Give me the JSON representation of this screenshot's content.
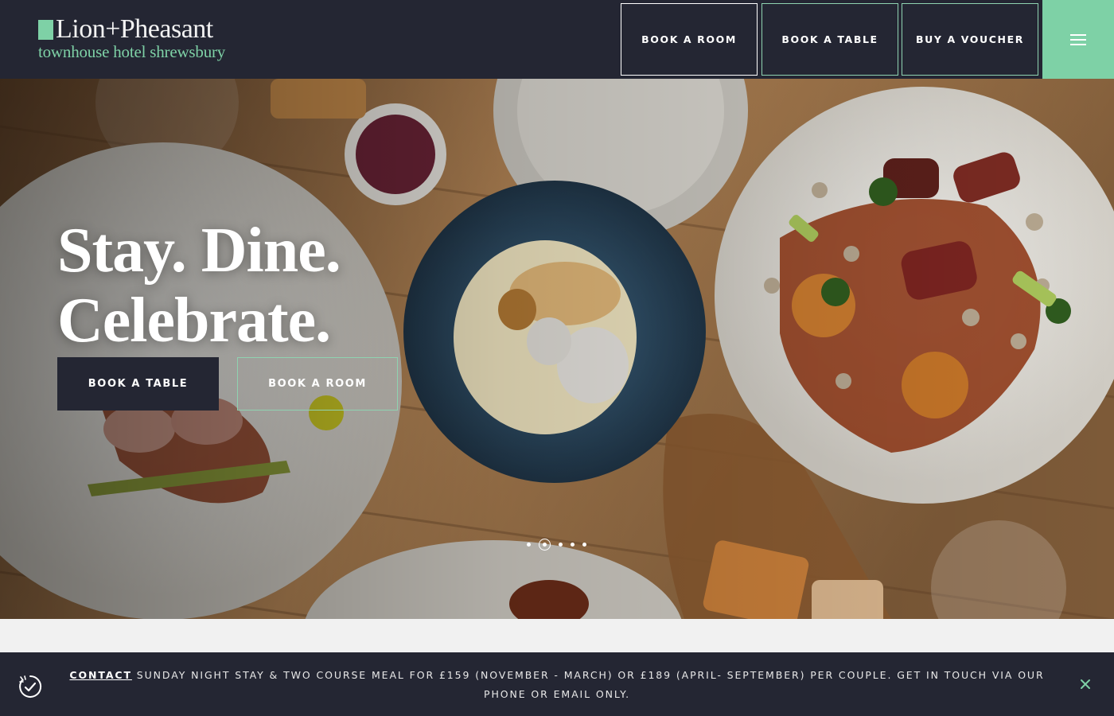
{
  "header": {
    "logo_main": "Lion+Pheasant",
    "logo_sub": "townhouse hotel shrewsbury",
    "nav": [
      {
        "label": "BOOK A ROOM"
      },
      {
        "label": "BOOK A TABLE"
      },
      {
        "label": "BUY A VOUCHER"
      }
    ],
    "menu_icon": "hamburger-icon"
  },
  "hero": {
    "title_line1": "Stay. Dine.",
    "title_line2": "Celebrate.",
    "primary_button": "BOOK A TABLE",
    "secondary_button": "BOOK A ROOM",
    "slides": 5,
    "active_slide": 2
  },
  "notice": {
    "link_label": "CONTACT",
    "text": " SUNDAY NIGHT STAY & TWO COURSE MEAL FOR £159 (NOVEMBER - MARCH) OR £189 (APRIL- SEPTEMBER) PER COUPLE. GET IN TOUCH VIA OUR PHONE OR EMAIL ONLY.",
    "icon": "offer-check-icon",
    "close_icon": "close-icon"
  },
  "colors": {
    "navy": "#242633",
    "accent_green": "#7ed1a6"
  }
}
